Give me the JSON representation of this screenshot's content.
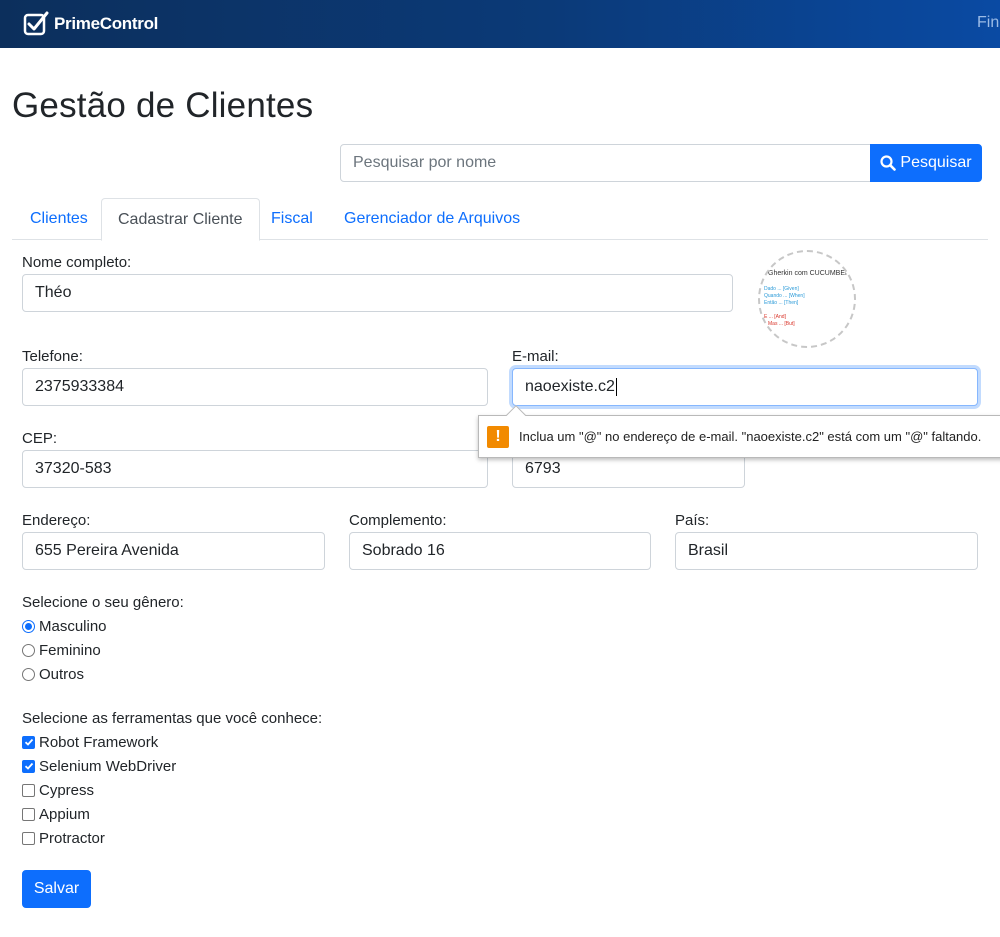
{
  "navbar": {
    "brand": "PrimeControl",
    "right_link": "Fin"
  },
  "page": {
    "title": "Gestão de Clientes"
  },
  "search": {
    "placeholder": "Pesquisar por nome",
    "button_label": "Pesquisar"
  },
  "tabs": [
    {
      "label": "Clientes",
      "active": false
    },
    {
      "label": "Cadastrar Cliente",
      "active": true
    },
    {
      "label": "Fiscal",
      "active": false
    },
    {
      "label": "Gerenciador de Arquivos",
      "active": false
    }
  ],
  "form": {
    "nome": {
      "label": "Nome completo:",
      "value": "Théo"
    },
    "telefone": {
      "label": "Telefone:",
      "value": "2375933384"
    },
    "email": {
      "label": "E-mail:",
      "value": "naoexiste.c2"
    },
    "cep": {
      "label": "CEP:",
      "value": "37320-583"
    },
    "numero": {
      "value": "6793"
    },
    "endereco": {
      "label": "Endereço:",
      "value": "655 Pereira Avenida"
    },
    "complemento": {
      "label": "Complemento:",
      "value": "Sobrado 16"
    },
    "pais": {
      "label": "País:",
      "value": "Brasil"
    }
  },
  "logo_image": {
    "title": "Gherkin com CUCUMBER",
    "lines_blue": [
      "Dado ... [Given]",
      "Quando ... [When]",
      "Então ... [Then]"
    ],
    "lines_red": [
      "E ... [And]",
      "Mas ... [But]"
    ]
  },
  "validation_tooltip": {
    "icon": "warning-icon",
    "text": "Inclua um \"@\" no endereço de e-mail. \"naoexiste.c2\" está com um \"@\" faltando."
  },
  "gender": {
    "label": "Selecione o seu gênero:",
    "options": [
      {
        "label": "Masculino",
        "selected": true
      },
      {
        "label": "Feminino",
        "selected": false
      },
      {
        "label": "Outros",
        "selected": false
      }
    ]
  },
  "tools": {
    "label": "Selecione as ferramentas que você conhece:",
    "options": [
      {
        "label": "Robot Framework",
        "checked": true
      },
      {
        "label": "Selenium WebDriver",
        "checked": true
      },
      {
        "label": "Cypress",
        "checked": false
      },
      {
        "label": "Appium",
        "checked": false
      },
      {
        "label": "Protractor",
        "checked": false
      }
    ]
  },
  "actions": {
    "save_label": "Salvar"
  },
  "colors": {
    "primary": "#0d6efd",
    "navbar_dark": "#0c2f5c",
    "warning": "#f28a00"
  }
}
